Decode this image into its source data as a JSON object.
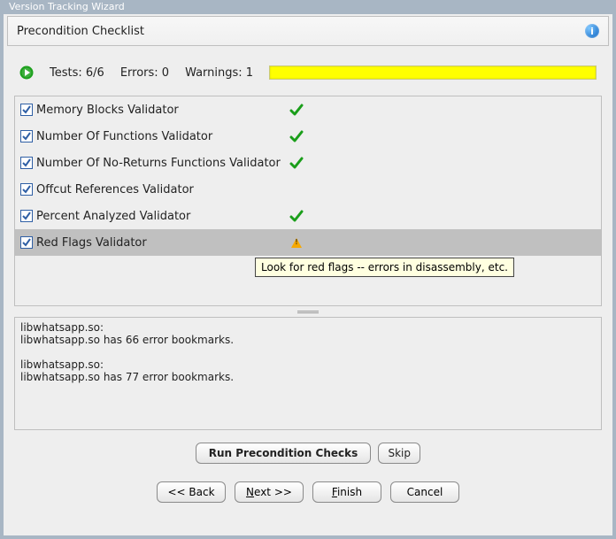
{
  "window": {
    "title": "Version Tracking Wizard"
  },
  "header": {
    "title": "Precondition Checklist"
  },
  "summary": {
    "tests_label": "Tests: 6/6",
    "errors_label": "Errors: 0",
    "warnings_label": "Warnings: 1"
  },
  "validators": [
    {
      "label": "Memory Blocks Validator",
      "status": "ok",
      "checked": true
    },
    {
      "label": "Number Of Functions Validator",
      "status": "ok",
      "checked": true
    },
    {
      "label": "Number Of No-Returns Functions Validator",
      "status": "ok",
      "checked": true
    },
    {
      "label": "Offcut References Validator",
      "status": "none",
      "checked": true
    },
    {
      "label": "Percent Analyzed Validator",
      "status": "ok",
      "checked": true
    },
    {
      "label": "Red Flags Validator",
      "status": "warn",
      "checked": true,
      "selected": true
    }
  ],
  "tooltip": "Look for red flags -- errors in disassembly, etc.",
  "log": "libwhatsapp.so:\nlibwhatsapp.so has 66 error bookmarks.\n\nlibwhatsapp.so:\nlibwhatsapp.so has 77 error bookmarks.",
  "actions": {
    "run_checks": "Run Precondition Checks",
    "skip": "Skip"
  },
  "wizard": {
    "back": "<< Back",
    "next_mn": "N",
    "next_rest": "ext >>",
    "finish_mn": "F",
    "finish_rest": "inish",
    "cancel": "Cancel"
  }
}
